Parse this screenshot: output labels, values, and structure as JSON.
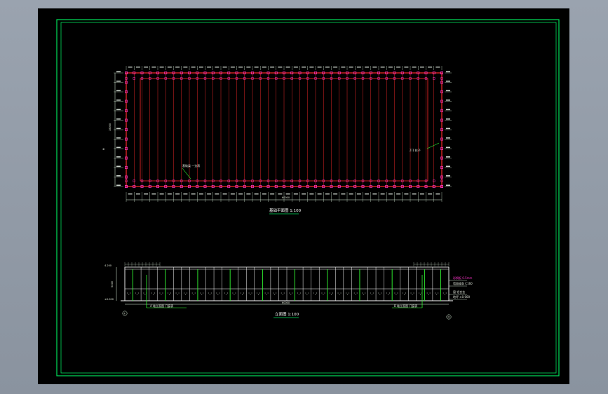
{
  "drawing": {
    "plan_title": "基础平面图 1:100",
    "elevation_title": "立面图 1:100",
    "plan_width_dim": "60000",
    "plan_height_dim": "18000",
    "elevation_width_dim": "60000",
    "elevation_height_dim": "5400",
    "plan_bays": 40,
    "plan_rows": 12,
    "elevation_bays": 40,
    "plan_note_left": "基础梁 一览表",
    "plan_note_right": "Z-1 柱子",
    "elev_note_left": "A 轴立面图 门窗表",
    "elev_note_right": "B 轴立面图 门窗表",
    "elev_legend": [
      "彩钢板 0.5mm",
      "墙面檩条 C160",
      "窗 铝合金",
      "地坪 ±0.000"
    ],
    "elev_level_top": "4.200",
    "elev_level_bot": "±0.000",
    "axis_left": "①",
    "axis_right": "⑪",
    "colors": {
      "frame": "#00e25a",
      "grid": "#ff2a2a",
      "column": "#ff33cc",
      "dim": "#e8ffe8",
      "line_white": "#ffffff",
      "accent_green": "#33ff33"
    }
  }
}
